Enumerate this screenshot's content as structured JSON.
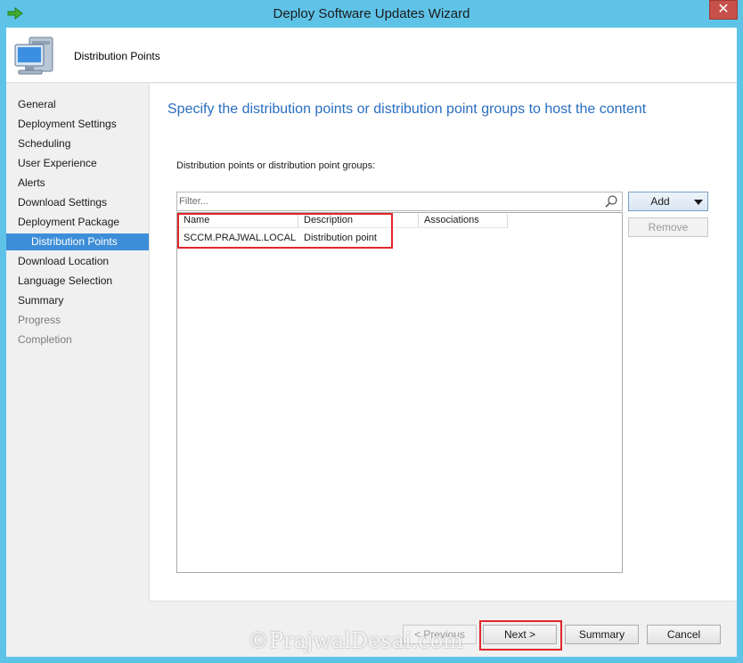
{
  "window": {
    "title": "Deploy Software Updates Wizard",
    "close_symbol": "✕",
    "app_icon": "green-arrow-icon",
    "close_color": "#c7504a",
    "frame_color": "#5fc3e8"
  },
  "header": {
    "title": "Distribution Points",
    "icon": "computer-icon"
  },
  "nav": {
    "items": [
      {
        "label": "General",
        "state": "normal"
      },
      {
        "label": "Deployment Settings",
        "state": "normal"
      },
      {
        "label": "Scheduling",
        "state": "normal"
      },
      {
        "label": "User Experience",
        "state": "normal"
      },
      {
        "label": "Alerts",
        "state": "normal"
      },
      {
        "label": "Download Settings",
        "state": "normal"
      },
      {
        "label": "Deployment Package",
        "state": "normal"
      },
      {
        "label": "Distribution Points",
        "state": "active"
      },
      {
        "label": "Download Location",
        "state": "normal"
      },
      {
        "label": "Language Selection",
        "state": "normal"
      },
      {
        "label": "Summary",
        "state": "normal"
      },
      {
        "label": "Progress",
        "state": "disabled"
      },
      {
        "label": "Completion",
        "state": "disabled"
      }
    ],
    "active_color": "#3d8ed8"
  },
  "main": {
    "heading": "Specify the distribution points or distribution point groups to host the content",
    "heading_color": "#2a6ebf",
    "list_label": "Distribution points or distribution point groups:",
    "filter": {
      "placeholder": "Filter...",
      "value": "",
      "icon": "search-icon"
    },
    "columns": [
      "Name",
      "Description",
      "Associations"
    ],
    "rows": [
      {
        "name": "SCCM.PRAJWAL.LOCAL",
        "description": "Distribution point",
        "associations": ""
      }
    ],
    "add_label": "Add",
    "remove_label": "Remove"
  },
  "footer": {
    "previous_label": "< Previous",
    "next_label": "Next >",
    "summary_label": "Summary",
    "cancel_label": "Cancel"
  },
  "annotations": {
    "highlight_color": "#e0262b"
  },
  "watermark": {
    "text": "©PrajwalDesai.com"
  }
}
